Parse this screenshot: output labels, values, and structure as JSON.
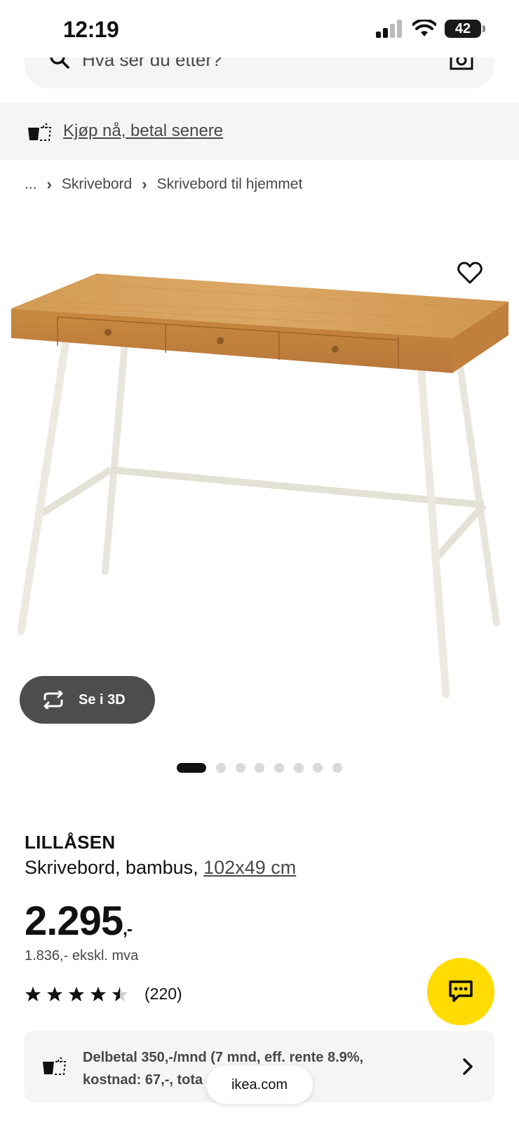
{
  "status_bar": {
    "time": "12:19",
    "battery": "42"
  },
  "search": {
    "placeholder": "Hva ser du etter?"
  },
  "banner": {
    "text": "Kjøp nå, betal senere"
  },
  "breadcrumb": {
    "ellipsis": "...",
    "items": [
      "Skrivebord",
      "Skrivebord til hjemmet"
    ]
  },
  "gallery": {
    "see_3d_label": "Se i 3D",
    "image_count": 8,
    "active_index": 0
  },
  "product": {
    "name": "LILLÅSEN",
    "description": "Skrivebord, bambus,",
    "dimensions": "102x49 cm",
    "price_main": "2.295",
    "price_suffix": ",-",
    "price_ex_vat": "1.836,- ekskl. mva",
    "rating_value": 4.5,
    "rating_max": 5,
    "review_count": "(220)"
  },
  "installment": {
    "line1": "Delbetal 350,-/mnd (7 mnd, eff. rente 8.9%,",
    "line2": "kostnad: 67,-, tota"
  },
  "browser": {
    "url": "ikea.com"
  },
  "colors": {
    "chat_button": "#ffdb00",
    "see_3d_bg": "#4d4d4d",
    "banner_bg": "#f5f5f5"
  }
}
